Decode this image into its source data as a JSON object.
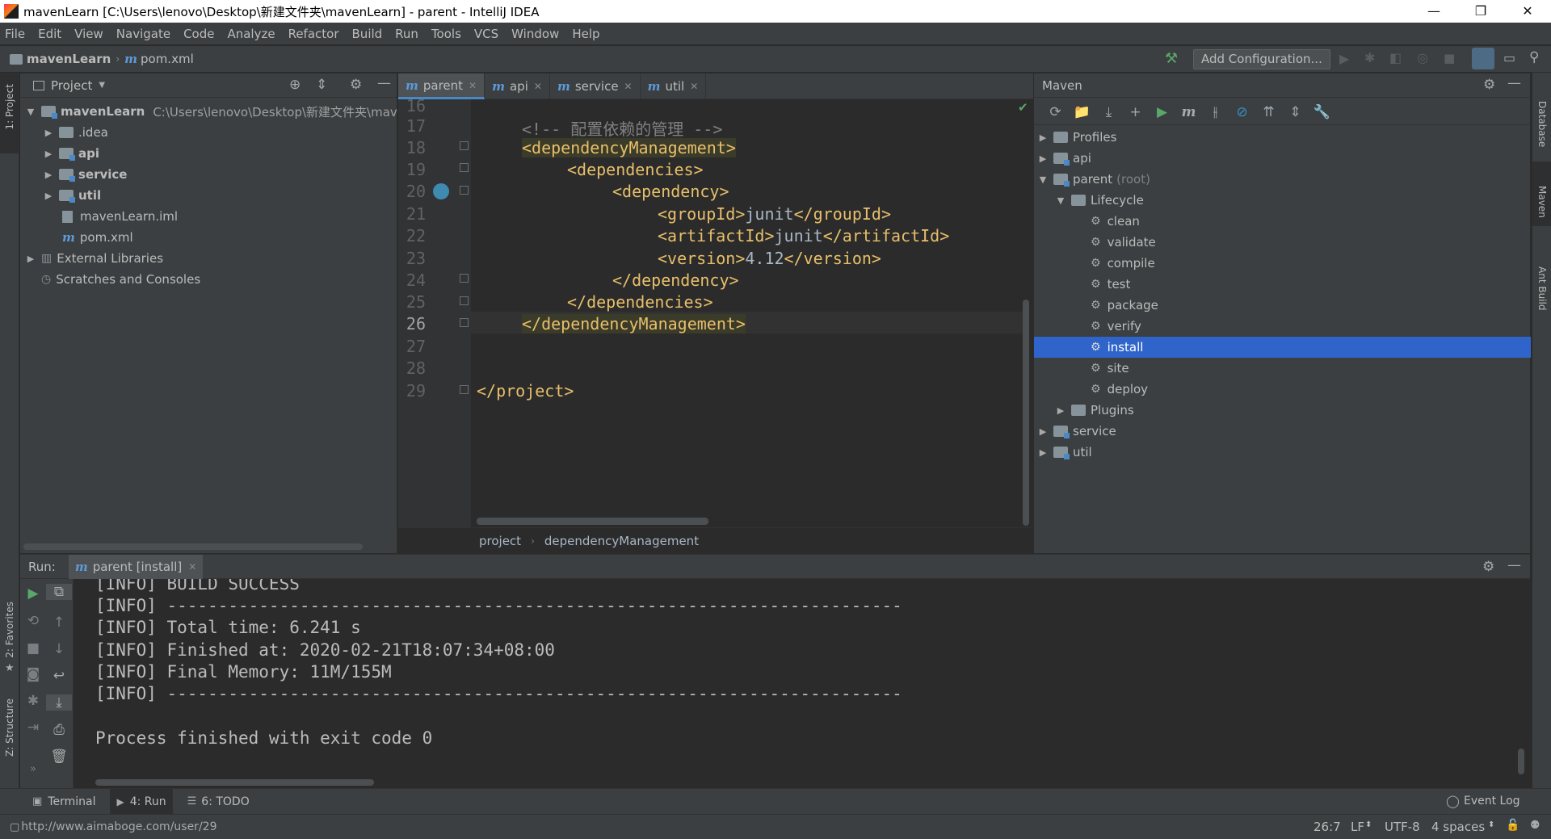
{
  "window": {
    "title": "mavenLearn [C:\\Users\\lenovo\\Desktop\\新建文件夹\\mavenLearn] - parent - IntelliJ IDEA",
    "minimize": "—",
    "restore": "❐",
    "close": "✕"
  },
  "menu": [
    "File",
    "Edit",
    "View",
    "Navigate",
    "Code",
    "Analyze",
    "Refactor",
    "Build",
    "Run",
    "Tools",
    "VCS",
    "Window",
    "Help"
  ],
  "navbar": {
    "project": "mavenLearn",
    "file": "pom.xml",
    "add_config": "Add Configuration..."
  },
  "side_strips": {
    "left_top": "1: Project",
    "left_fav": "2: Favorites",
    "left_struct": "Z: Structure",
    "right_db": "Database",
    "right_maven": "Maven",
    "right_ant": "Ant Build"
  },
  "project_panel": {
    "title": "Project",
    "root_name": "mavenLearn",
    "root_path": "C:\\Users\\lenovo\\Desktop\\新建文件夹\\maven",
    "items": [
      ".idea",
      "api",
      "service",
      "util",
      "mavenLearn.iml",
      "pom.xml"
    ],
    "external": "External Libraries",
    "scratches": "Scratches and Consoles"
  },
  "editor": {
    "tabs": [
      "parent",
      "api",
      "service",
      "util"
    ],
    "line_numbers": [
      "16",
      "17",
      "18",
      "19",
      "20",
      "21",
      "22",
      "23",
      "24",
      "25",
      "26",
      "27",
      "28",
      "29"
    ],
    "lines": {
      "l17": "<!-- 配置依赖的管理 -->",
      "l18": "<dependencyManagement>",
      "l19": "<dependencies>",
      "l20": "<dependency>",
      "l21_open": "<groupId>",
      "l21_val": "junit",
      "l21_close": "</groupId>",
      "l22_open": "<artifactId>",
      "l22_val": "junit",
      "l22_close": "</artifactId>",
      "l23_open": "<version>",
      "l23_val": "4.12",
      "l23_close": "</version>",
      "l24": "</dependency>",
      "l25": "</dependencies>",
      "l26": "</dependencyManagement>",
      "l29": "</project>"
    },
    "breadcrumb": [
      "project",
      "dependencyManagement"
    ]
  },
  "maven_panel": {
    "title": "Maven",
    "profiles": "Profiles",
    "api": "api",
    "parent": "parent",
    "parent_suffix": "(root)",
    "lifecycle": "Lifecycle",
    "phases": [
      "clean",
      "validate",
      "compile",
      "test",
      "package",
      "verify",
      "install",
      "site",
      "deploy"
    ],
    "selected_phase": "install",
    "plugins": "Plugins",
    "service": "service",
    "util": "util"
  },
  "run_panel": {
    "label": "Run:",
    "tab": "parent [install]",
    "lines": [
      "[INFO] BUILD SUCCESS",
      "[INFO] ------------------------------------------------------------------------",
      "[INFO] Total time: 6.241 s",
      "[INFO] Finished at: 2020-02-21T18:07:34+08:00",
      "[INFO] Final Memory: 11M/155M",
      "[INFO] ------------------------------------------------------------------------",
      "",
      "Process finished with exit code 0"
    ]
  },
  "toolwindows": {
    "terminal": "Terminal",
    "run": "4: Run",
    "todo": "6: TODO",
    "event_log": "Event Log"
  },
  "status": {
    "url": "http://www.aimaboge.com/user/29",
    "position": "26:7",
    "line_sep": "LF",
    "encoding": "UTF-8",
    "indent": "4 spaces"
  },
  "colors": {
    "bg": "#2b2b2b",
    "panel": "#3c3f41",
    "accent": "#4a88c7",
    "selection": "#2f65ca",
    "xml_tag": "#e8bf6a",
    "comment": "#808080"
  }
}
